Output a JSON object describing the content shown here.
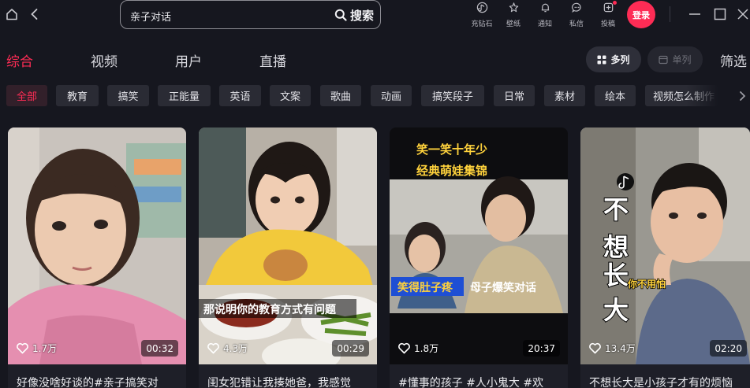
{
  "search": {
    "query": "亲子对话",
    "button_label": "搜索"
  },
  "top_tools": [
    {
      "label": "充钻石",
      "icon": "diamond-icon"
    },
    {
      "label": "壁纸",
      "icon": "wallpaper-icon"
    },
    {
      "label": "通知",
      "icon": "bell-icon"
    },
    {
      "label": "私信",
      "icon": "message-icon"
    },
    {
      "label": "投稿",
      "icon": "upload-icon"
    }
  ],
  "login_label": "登录",
  "tabs": [
    {
      "label": "综合",
      "active": true
    },
    {
      "label": "视频",
      "active": false
    },
    {
      "label": "用户",
      "active": false
    },
    {
      "label": "直播",
      "active": false
    }
  ],
  "view_modes": {
    "multi": "多列",
    "single": "单列"
  },
  "filter_label": "筛选",
  "chips": [
    "全部",
    "教育",
    "搞笑",
    "正能量",
    "英语",
    "文案",
    "歌曲",
    "动画",
    "搞笑段子",
    "日常",
    "素材",
    "绘本",
    "视频怎么制作"
  ],
  "active_chip": "全部",
  "videos": [
    {
      "likes": "1.7万",
      "duration": "00:32",
      "title": "好像没啥好谈的#亲子搞笑对",
      "overlay": []
    },
    {
      "likes": "4.3万",
      "duration": "00:29",
      "title": "闺女犯错让我揍她爸，我感觉",
      "overlay": [
        "那说明你的教育方式有问题"
      ]
    },
    {
      "likes": "1.8万",
      "duration": "20:37",
      "title": "#懂事的孩子 #人小鬼大 #欢",
      "overlay": [
        "笑一笑十年少",
        "经典萌娃集锦",
        "笑得肚子疼",
        "母子爆笑对话"
      ]
    },
    {
      "likes": "13.4万",
      "duration": "02:20",
      "title": "不想长大是小孩子才有的烦恼",
      "overlay": [
        "不",
        "想",
        "长",
        "大",
        "你不用怕"
      ]
    }
  ],
  "colors": {
    "accent": "#fe2c55",
    "background": "#16171f",
    "chip": "#2a2b34",
    "highlight_yellow": "#ffd23c"
  }
}
